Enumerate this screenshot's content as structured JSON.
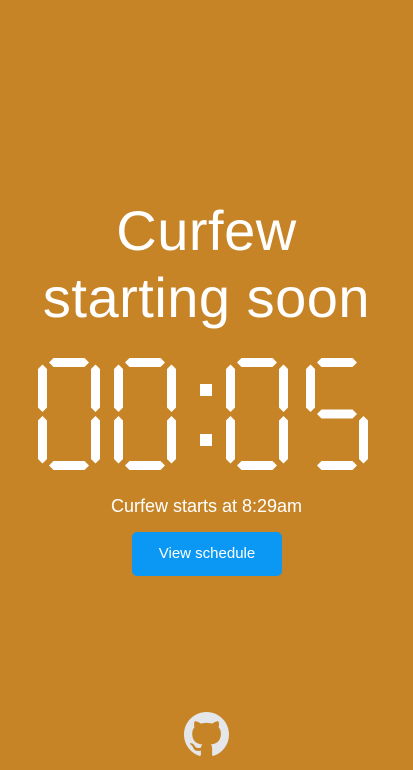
{
  "page": {
    "background": "#c68426"
  },
  "header": {
    "title_line1": "Curfew",
    "title_line2": "starting soon"
  },
  "countdown": {
    "value": "00:05",
    "minutes": "00",
    "seconds": "05"
  },
  "info": {
    "curfew_start_text": "Curfew starts at 8:29am"
  },
  "actions": {
    "view_schedule_label": "View schedule",
    "button_color": "#0a98f4"
  },
  "footer": {
    "icon": "github-icon"
  }
}
